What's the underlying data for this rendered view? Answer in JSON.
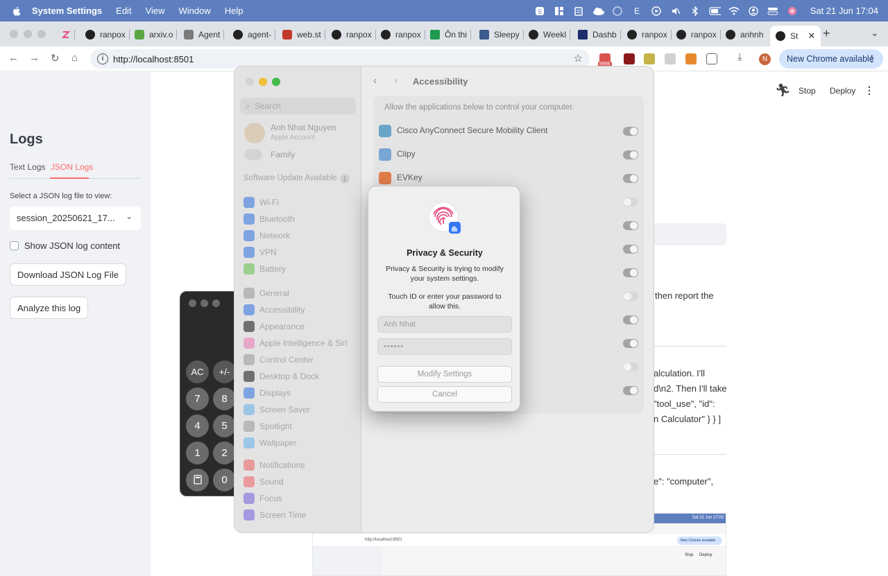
{
  "menubar": {
    "app_name": "System Settings",
    "items": [
      "Edit",
      "View",
      "Window",
      "Help"
    ],
    "status_letter": "E",
    "clock": "Sat 21 Jun  17:04"
  },
  "browser": {
    "tabs": [
      {
        "label": "ranpox"
      },
      {
        "label": "arxiv.o"
      },
      {
        "label": "Agent"
      },
      {
        "label": "agent-"
      },
      {
        "label": "web.st"
      },
      {
        "label": "ranpox"
      },
      {
        "label": "ranpox"
      },
      {
        "label": "Ôn thi"
      },
      {
        "label": "Sleepy"
      },
      {
        "label": "Weekl"
      },
      {
        "label": "Dashb"
      },
      {
        "label": "ranpox"
      },
      {
        "label": "ranpox"
      },
      {
        "label": "anhnh"
      },
      {
        "label": "St"
      }
    ],
    "url": "http://localhost:8501",
    "extension_badge": "8996",
    "profile_initial": "N",
    "new_chrome_label": "New Chrome available"
  },
  "streamlit": {
    "sidebar": {
      "title": "Logs",
      "tabs": [
        "Text Logs",
        "JSON Logs"
      ],
      "active_tab": "JSON Logs",
      "select_label": "Select a JSON log file to view:",
      "select_value": "session_20250621_17...",
      "checkbox_label": "Show JSON log content",
      "download_button": "Download JSON Log File",
      "analyze_button": "Analyze this log"
    },
    "header": {
      "stop_label": "Stop",
      "deploy_label": "Deploy"
    },
    "main_fragments": [
      "then report the",
      "alculation. I'll",
      "d\\n2. Then I'll take",
      "\"tool_use\", \"id\":",
      "n Calculator\" } } ]",
      "e\": \"computer\","
    ],
    "thumbnail": {
      "clock": "Sat 21 Jun  17:03",
      "url": "http://localhost:8501",
      "new_chrome_label": "New Chrome available",
      "stop_label": "Stop",
      "deploy_label": "Deploy"
    }
  },
  "calculator": {
    "keys": [
      "AC",
      "+/-",
      "7",
      "8",
      "4",
      "5",
      "1",
      "2",
      "0"
    ]
  },
  "system_settings": {
    "search_placeholder": "Search",
    "account_name": "Anh Nhat Nguyen",
    "account_sub": "Apple Account",
    "family_label": "Family",
    "update_label": "Software Update Available",
    "update_count": "1",
    "sidebar_items": [
      {
        "label": "Wi-Fi",
        "color": "#7ea3e0"
      },
      {
        "label": "Bluetooth",
        "color": "#7ea3e0"
      },
      {
        "label": "Network",
        "color": "#7ea3e0"
      },
      {
        "label": "VPN",
        "color": "#7ea3e0"
      },
      {
        "label": "Battery",
        "color": "#9bd08f"
      },
      {
        "label": "General",
        "color": "#b9b9bc"
      },
      {
        "label": "Accessibility",
        "color": "#7ea3e0"
      },
      {
        "label": "Appearance",
        "color": "#6f6f72"
      },
      {
        "label": "Apple Intelligence & Siri",
        "color": "#e7a8c8"
      },
      {
        "label": "Control Center",
        "color": "#b9b9bc"
      },
      {
        "label": "Desktop & Dock",
        "color": "#6f6f72"
      },
      {
        "label": "Displays",
        "color": "#7ea3e0"
      },
      {
        "label": "Screen Saver",
        "color": "#9cc6e6"
      },
      {
        "label": "Spotlight",
        "color": "#b9b9bc"
      },
      {
        "label": "Wallpaper",
        "color": "#9cc6e6"
      },
      {
        "label": "Notifications",
        "color": "#ea9a9a"
      },
      {
        "label": "Sound",
        "color": "#ea9a9a"
      },
      {
        "label": "Focus",
        "color": "#a59ae0"
      },
      {
        "label": "Screen Time",
        "color": "#a59ae0"
      }
    ],
    "page_title": "Accessibility",
    "caption": "Allow the applications below to control your computer.",
    "apps": [
      {
        "name": "Cisco AnyConnect Secure Mobility Client",
        "enabled": true,
        "color": "#6aa5c8"
      },
      {
        "name": "Clipy",
        "enabled": true,
        "color": "#7aa6d6"
      },
      {
        "name": "EVKey",
        "enabled": true,
        "color": "#e27d4a"
      },
      {
        "name": "",
        "enabled": false,
        "color": "#cfcfcf"
      },
      {
        "name": "",
        "enabled": true,
        "color": "#cfcfcf"
      },
      {
        "name": "",
        "enabled": true,
        "color": "#cfcfcf"
      },
      {
        "name": "",
        "enabled": true,
        "color": "#cfcfcf"
      },
      {
        "name": "",
        "enabled": false,
        "color": "#cfcfcf"
      },
      {
        "name": "",
        "enabled": true,
        "color": "#cfcfcf"
      },
      {
        "name": "",
        "enabled": true,
        "color": "#cfcfcf"
      },
      {
        "name": "",
        "enabled": false,
        "color": "#cfcfcf"
      },
      {
        "name": "",
        "enabled": true,
        "color": "#cfcfcf"
      }
    ]
  },
  "dialog": {
    "title": "Privacy & Security",
    "message": "Privacy & Security is trying to modify your system settings.",
    "prompt": "Touch ID or enter your password to allow this.",
    "username_value": "Anh Nhat",
    "password_value": "••••••",
    "modify_button": "Modify Settings",
    "cancel_button": "Cancel",
    "accent_color": "#e8457a"
  }
}
